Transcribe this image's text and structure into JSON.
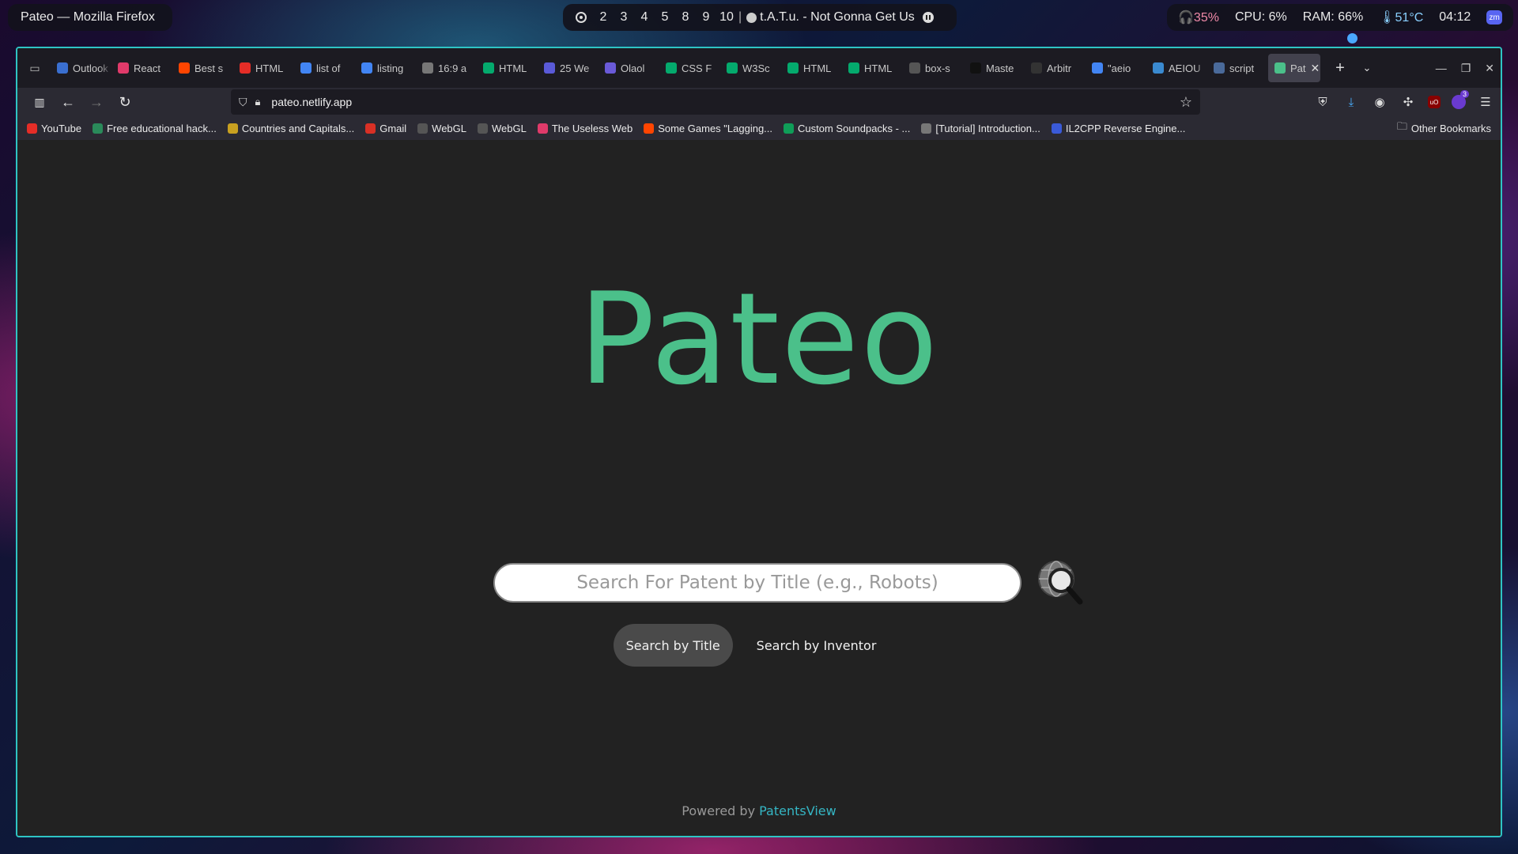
{
  "system_bar": {
    "window_title": "Pateo — Mozilla Firefox",
    "workspaces": [
      "2",
      "3",
      "4",
      "5",
      "8",
      "9",
      "10"
    ],
    "separator": "|",
    "now_playing": "t.A.T.u. - Not Gonna Get Us",
    "headphone_battery": "35%",
    "cpu": "CPU: 6%",
    "ram": "RAM: 66%",
    "temperature": "51°C",
    "clock": "04:12",
    "discord_badge": "zm"
  },
  "tabs": [
    {
      "label": "Outlook",
      "icon": "outlook-icon",
      "color": "#3a6fd0"
    },
    {
      "label": "React",
      "icon": "react-icon",
      "color": "#e03a6a"
    },
    {
      "label": "Best s",
      "icon": "reddit-icon",
      "color": "#ff4500"
    },
    {
      "label": "HTML",
      "icon": "youtube-icon",
      "color": "#e52d27"
    },
    {
      "label": "list of",
      "icon": "google-icon",
      "color": "#4285f4"
    },
    {
      "label": "listing",
      "icon": "google-icon",
      "color": "#4285f4"
    },
    {
      "label": "16:9 a",
      "icon": "wikipedia-icon",
      "color": "#777777"
    },
    {
      "label": "HTML",
      "icon": "w3schools-icon",
      "color": "#04aa6d"
    },
    {
      "label": "25 We",
      "icon": "site-icon",
      "color": "#5a5ad8"
    },
    {
      "label": "Olaol",
      "icon": "pin-icon",
      "color": "#6a5ad8"
    },
    {
      "label": "CSS F",
      "icon": "w3schools-icon",
      "color": "#04aa6d"
    },
    {
      "label": "W3Sc",
      "icon": "w3schools-icon",
      "color": "#04aa6d"
    },
    {
      "label": "HTML",
      "icon": "w3schools-icon",
      "color": "#04aa6d"
    },
    {
      "label": "HTML",
      "icon": "w3schools-icon",
      "color": "#04aa6d"
    },
    {
      "label": "box-s",
      "icon": "mdn-icon",
      "color": "#555555"
    },
    {
      "label": "Maste",
      "icon": "medium-icon",
      "color": "#111111"
    },
    {
      "label": "Arbitr",
      "icon": "github-icon",
      "color": "#333333"
    },
    {
      "label": "\"aeio",
      "icon": "google-icon",
      "color": "#4285f4"
    },
    {
      "label": "AEIOU",
      "icon": "site-icon",
      "color": "#3a8ad0"
    },
    {
      "label": "script",
      "icon": "script-icon",
      "color": "#4a6a9a"
    },
    {
      "label": "Pat",
      "icon": "pateo-icon",
      "color": "#4bc08a",
      "active": true
    }
  ],
  "new_tab_symbol": "+",
  "url": "pateo.netlify.app",
  "bookmarks": [
    {
      "label": "YouTube",
      "icon": "youtube-icon",
      "color": "#e52d27"
    },
    {
      "label": "Free educational hack...",
      "icon": "hack-icon",
      "color": "#2a8a5a"
    },
    {
      "label": "Countries and Capitals...",
      "icon": "countries-icon",
      "color": "#c8a020"
    },
    {
      "label": "Gmail",
      "icon": "gmail-icon",
      "color": "#d93025"
    },
    {
      "label": "WebGL",
      "icon": "globe-icon",
      "color": "#555555"
    },
    {
      "label": "WebGL",
      "icon": "globe-icon",
      "color": "#555555"
    },
    {
      "label": "The Useless Web",
      "icon": "useless-web-icon",
      "color": "#e03a6a"
    },
    {
      "label": "Some Games \"Lagging...",
      "icon": "reddit-icon",
      "color": "#ff4500"
    },
    {
      "label": "Custom Soundpacks - ...",
      "icon": "sheets-icon",
      "color": "#0f9d58"
    },
    {
      "label": "[Tutorial] Introduction...",
      "icon": "forum-icon",
      "color": "#777777"
    },
    {
      "label": "IL2CPP Reverse Engine...",
      "icon": "wordpress-icon",
      "color": "#3a5ad8"
    }
  ],
  "other_bookmarks": "Other Bookmarks",
  "page": {
    "logo": "Pateo",
    "search_placeholder": "Search For Patent by Title (e.g., Robots)",
    "mode_title": "Search by Title",
    "mode_inventor": "Search by Inventor",
    "footer_prefix": "Powered by ",
    "footer_link": "PatentsView"
  },
  "colors": {
    "brand_green": "#4bc08a",
    "window_border": "#2ec4c4",
    "link": "#35b6c4",
    "page_bg": "#222222"
  }
}
